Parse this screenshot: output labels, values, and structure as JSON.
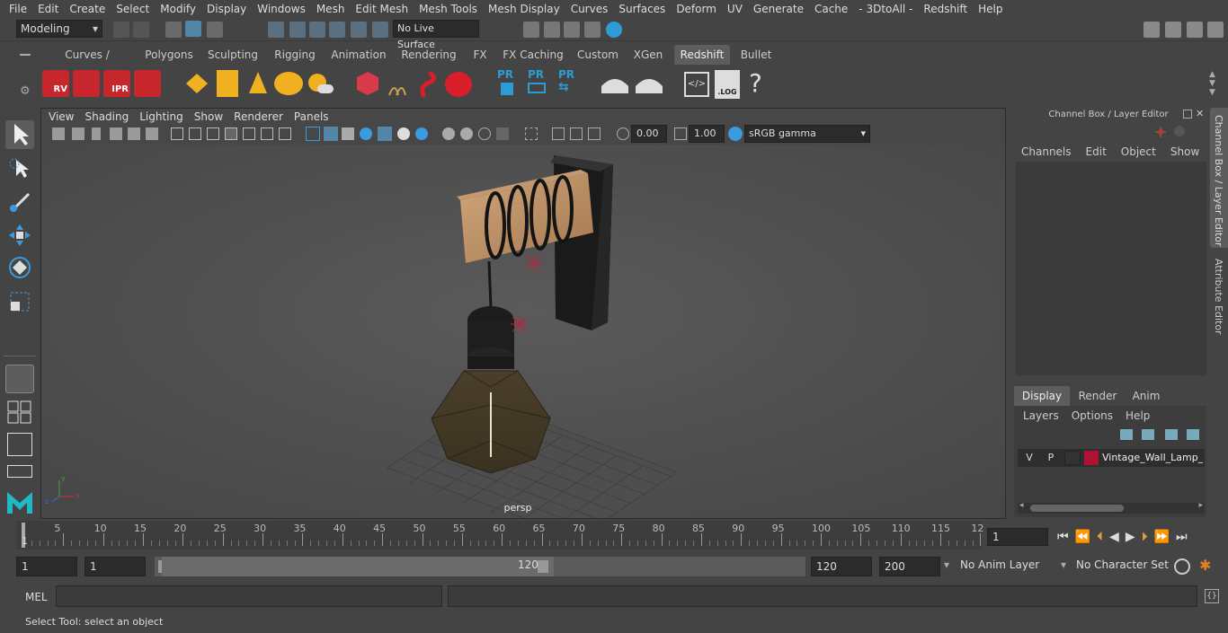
{
  "menubar": [
    "File",
    "Edit",
    "Create",
    "Select",
    "Modify",
    "Display",
    "Windows",
    "Mesh",
    "Edit Mesh",
    "Mesh Tools",
    "Mesh Display",
    "Curves",
    "Surfaces",
    "Deform",
    "UV",
    "Generate",
    "Cache",
    "- 3DtoAll -",
    "Redshift",
    "Help"
  ],
  "status": {
    "mode": "Modeling",
    "live_surface": "No Live Surface"
  },
  "shelf_tabs": [
    "Curves / Surfaces",
    "Polygons",
    "Sculpting",
    "Rigging",
    "Animation",
    "Rendering",
    "FX",
    "FX Caching",
    "Custom",
    "XGen",
    "Redshift",
    "Bullet"
  ],
  "shelf_active": "Redshift",
  "shelf_icons": {
    "rv": "RV",
    "ipr": "IPR",
    "pr1": "PR",
    "pr2": "PR",
    "pr3": "PR",
    "log": ".LOG",
    "help": "?"
  },
  "viewport": {
    "menu": [
      "View",
      "Shading",
      "Lighting",
      "Show",
      "Renderer",
      "Panels"
    ],
    "exposure": "0.00",
    "gamma": "1.00",
    "colorspace": "sRGB gamma",
    "camera": "persp"
  },
  "channel_box": {
    "title": "Channel Box / Layer Editor",
    "menu": [
      "Channels",
      "Edit",
      "Object",
      "Show"
    ],
    "layer_tabs": [
      "Display",
      "Render",
      "Anim"
    ],
    "layer_menu": [
      "Layers",
      "Options",
      "Help"
    ],
    "layer": {
      "v": "V",
      "p": "P",
      "name": "Vintage_Wall_Lamp_Bl",
      "color": "#b01230"
    }
  },
  "side_tabs": [
    "Channel Box / Layer Editor",
    "Attribute Editor"
  ],
  "timeline": {
    "ticks": [
      "5",
      "10",
      "15",
      "20",
      "25",
      "30",
      "35",
      "40",
      "45",
      "50",
      "55",
      "60",
      "65",
      "70",
      "75",
      "80",
      "85",
      "90",
      "95",
      "100",
      "105",
      "110",
      "115",
      "12"
    ],
    "start_label": "1",
    "current_frame": "1"
  },
  "range": {
    "start": "1",
    "playback_start": "1",
    "slider_start": "1",
    "slider_end": "120",
    "playback_end": "120",
    "end": "200",
    "anim_layer": "No Anim Layer",
    "character_set": "No Character Set"
  },
  "cmd": {
    "label": "MEL"
  },
  "help": "Select Tool: select an object",
  "colors": {
    "accent": "#5285a6",
    "layer": "#b01230",
    "active_tab": "#5d5d5d"
  }
}
